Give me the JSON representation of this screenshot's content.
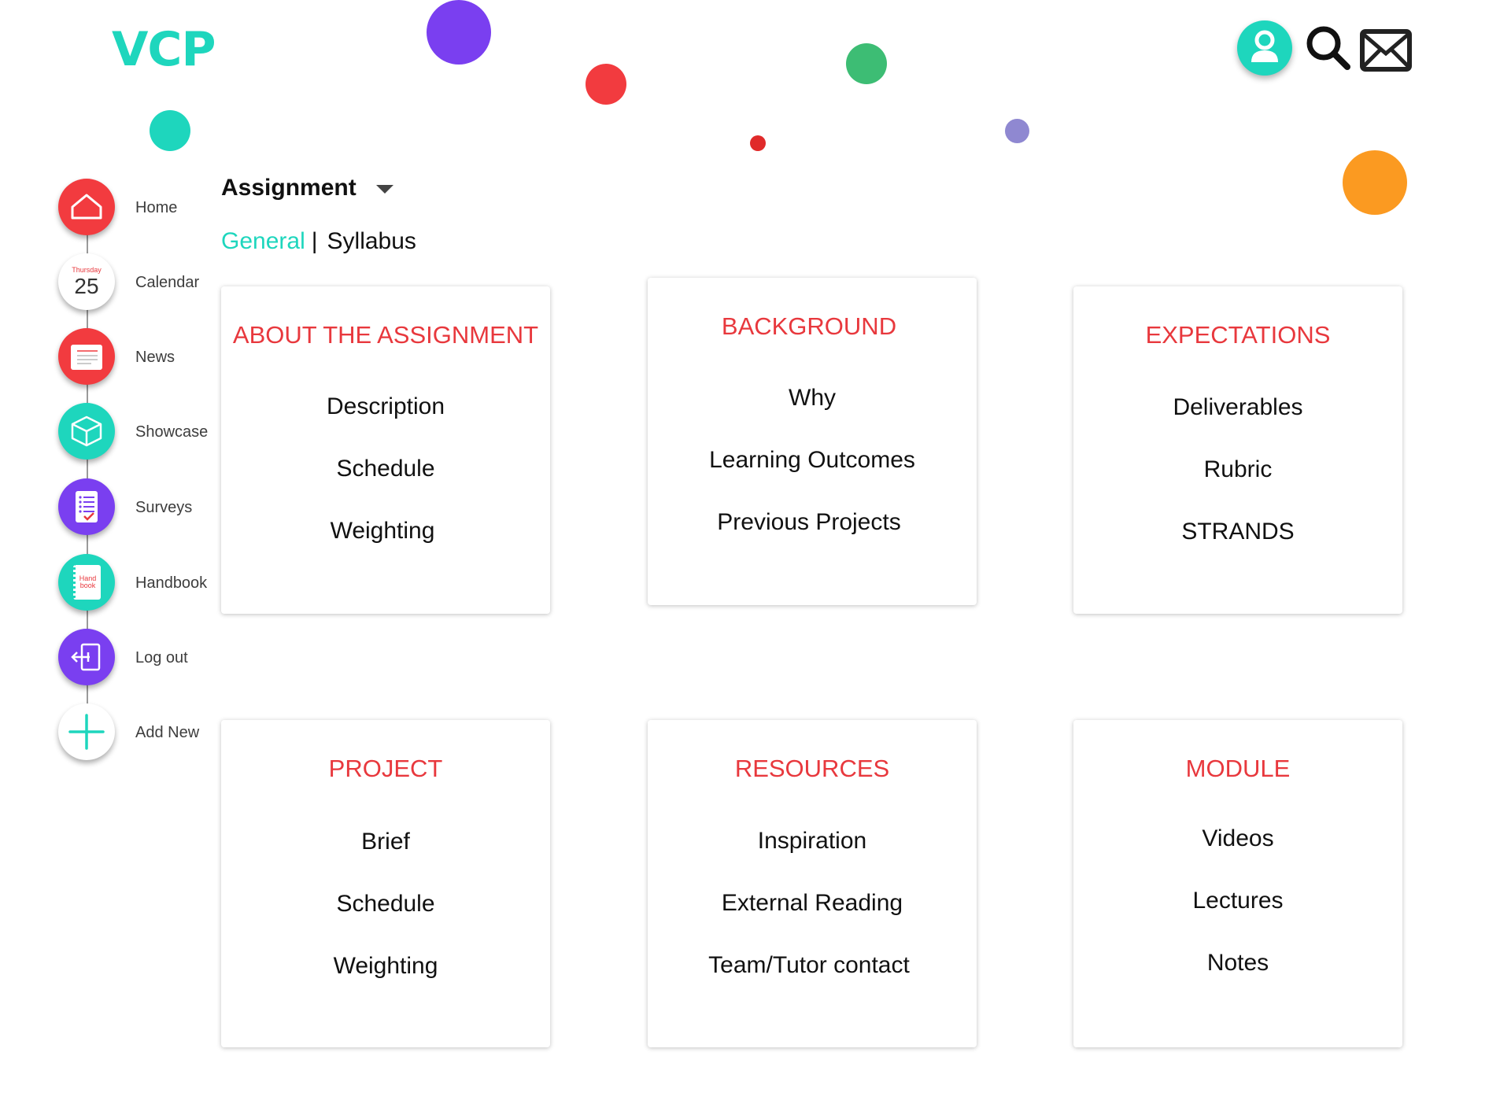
{
  "app": {
    "logo": "VCP"
  },
  "header": {
    "profile_icon": "user-icon",
    "search_icon": "search-icon",
    "mail_icon": "mail-icon"
  },
  "sidebar": {
    "items": [
      {
        "label": "Home",
        "icon": "home-icon",
        "color": "#f23b3f"
      },
      {
        "label": "Calendar",
        "icon": "calendar-icon",
        "color": "#ffffff",
        "day_name": "Thursday",
        "day_number": "25"
      },
      {
        "label": "News",
        "icon": "news-icon",
        "color": "#f23b3f"
      },
      {
        "label": "Showcase",
        "icon": "cube-icon",
        "color": "#1ed6bd"
      },
      {
        "label": "Surveys",
        "icon": "survey-icon",
        "color": "#7a3ff0"
      },
      {
        "label": "Handbook",
        "icon": "handbook-icon",
        "color": "#1ed6bd",
        "book_text_1": "Hand",
        "book_text_2": "book"
      },
      {
        "label": "Log out",
        "icon": "logout-icon",
        "color": "#7a3ff0"
      },
      {
        "label": "Add New",
        "icon": "plus-icon",
        "color": "#ffffff"
      }
    ]
  },
  "main": {
    "title": "Assignment",
    "tabs": [
      {
        "label": "General",
        "active": true
      },
      {
        "label": "Syllabus",
        "active": false
      }
    ],
    "tab_separator": "|",
    "cards": [
      {
        "title": "ABOUT THE ASSIGNMENT",
        "items": [
          "Description",
          "Schedule",
          "Weighting"
        ]
      },
      {
        "title": "BACKGROUND",
        "items": [
          "Why",
          "Learning Outcomes",
          "Previous Projects"
        ]
      },
      {
        "title": "EXPECTATIONS",
        "items": [
          "Deliverables",
          "Rubric",
          "STRANDS"
        ]
      },
      {
        "title": "PROJECT",
        "items": [
          "Brief",
          "Schedule",
          "Weighting"
        ]
      },
      {
        "title": "RESOURCES",
        "items": [
          "Inspiration",
          "External Reading",
          "Team/Tutor contact"
        ]
      },
      {
        "title": "MODULE",
        "items": [
          "Videos",
          "Lectures",
          "Notes"
        ]
      }
    ]
  },
  "colors": {
    "accent": "#1ed6bd",
    "title_red": "#e8383d",
    "purple": "#7a3ff0",
    "orange": "#fb9a21",
    "green": "#3dbd74",
    "lavender": "#8f88d1"
  }
}
